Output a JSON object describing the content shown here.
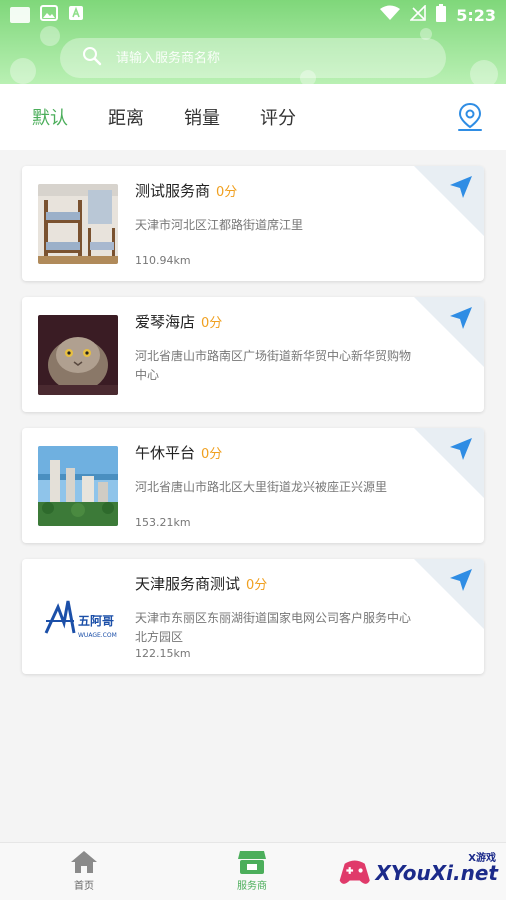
{
  "status_bar": {
    "time": "5:23"
  },
  "search": {
    "placeholder": "请输入服务商名称"
  },
  "tabs": [
    {
      "label": "默认",
      "active": true
    },
    {
      "label": "距离",
      "active": false
    },
    {
      "label": "销量",
      "active": false
    },
    {
      "label": "评分",
      "active": false
    }
  ],
  "stores": [
    {
      "name": "测试服务商",
      "score": "0分",
      "address": "天津市河北区江都路街道席江里",
      "distance": "110.94km",
      "thumb": "bunk-bed-photo"
    },
    {
      "name": "爱琴海店",
      "score": "0分",
      "address": "河北省唐山市路南区广场街道新华贸中心新华贸购物中心",
      "distance": "",
      "thumb": "cat-photo"
    },
    {
      "name": "午休平台",
      "score": "0分",
      "address": "河北省唐山市路北区大里街道龙兴被座正兴源里",
      "distance": "153.21km",
      "thumb": "buildings-photo"
    },
    {
      "name": "天津服务商测试",
      "score": "0分",
      "address": "天津市东丽区东丽湖街道国家电网公司客户服务中心北方园区",
      "distance": "122.15km",
      "thumb": "wuage-logo"
    }
  ],
  "bottom_nav": [
    {
      "label": "首页",
      "icon": "home-icon",
      "active": false
    },
    {
      "label": "服务商",
      "icon": "shop-icon",
      "active": true
    }
  ],
  "logo_text": {
    "wuage_cn": "五阿哥",
    "wuage_en": "WUAGE.COM"
  },
  "watermark": {
    "text": "XYouXi.net",
    "sub": "X游戏"
  },
  "colors": {
    "accent": "#4cae5b",
    "score": "#f0a020",
    "nav_arrow": "#2f8de4"
  }
}
